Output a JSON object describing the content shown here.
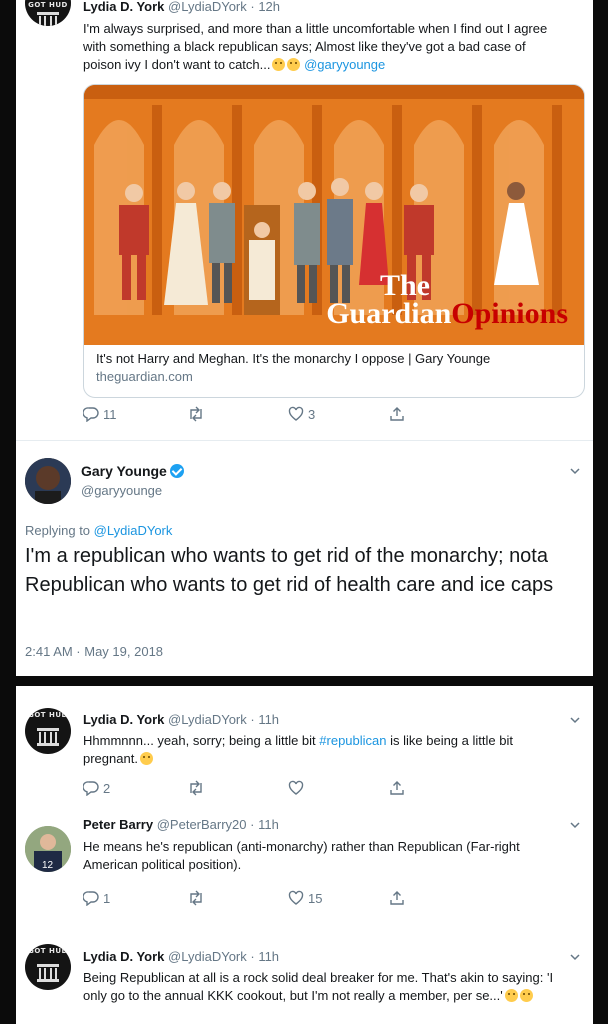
{
  "tweet1": {
    "name": "Lydia D. York",
    "handle": "@LydiaDYork",
    "time": "· 12h",
    "text": "I'm always surprised, and more than a little uncomfortable when I find out I agree with something a black republican says; Almost like they've got a bad case of poison ivy I don't want to catch...",
    "mention": "@garyyounge",
    "card": {
      "logo_the": "The",
      "logo_guardian": "Guardian",
      "logo_opinions": "Opinions",
      "title": "It's not Harry and Meghan. It's the monarchy I oppose | Gary Younge",
      "domain": "theguardian.com"
    },
    "replies": "11",
    "retweets": "",
    "likes": "3"
  },
  "focus": {
    "name": "Gary Younge",
    "handle": "@garyyounge",
    "replying_prefix": "Replying to",
    "replying_to": "@LydiaDYork",
    "text": "I'm a republican who wants to get rid of the monarchy; nota Republican who wants to get rid of health care and ice caps",
    "timestamp": "2:41 AM · May 19, 2018"
  },
  "reply1": {
    "name": "Lydia D. York",
    "handle": "@LydiaDYork",
    "time": "· 11h",
    "text_pre": "Hhmmnnn... yeah, sorry; being a little bit ",
    "hashtag": "#republican",
    "text_post": " is like being a little bit pregnant.",
    "replies": "2",
    "retweets": "",
    "likes": ""
  },
  "reply2": {
    "name": "Peter Barry",
    "handle": "@PeterBarry20",
    "time": "· 11h",
    "text": "He means he's republican (anti-monarchy) rather than Republican (Far-right American political position).",
    "replies": "1",
    "retweets": "",
    "likes": "15"
  },
  "reply3": {
    "name": "Lydia D. York",
    "handle": "@LydiaDYork",
    "time": "· 11h",
    "text": "Being Republican at all is a rock solid deal breaker for me. That's akin to saying: 'I only go to the annual KKK cookout, but I'm not really a member, per se...'"
  },
  "avatar_mark": "GOT HUD",
  "colors": {
    "link": "#1b95e0",
    "secondary": "#657786",
    "guardian_red": "#c70000",
    "card_bg": "#e47a1f"
  },
  "icons": [
    "reply-icon",
    "retweet-icon",
    "like-icon",
    "share-icon",
    "caret-down-icon",
    "verified-icon"
  ]
}
